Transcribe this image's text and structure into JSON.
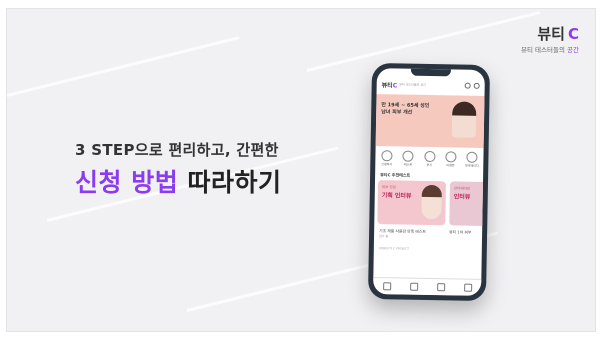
{
  "brand": {
    "logo_text": "뷰티",
    "logo_c": "C",
    "tagline_main": "뷰티 테스터들의",
    "tagline_accent": "공간"
  },
  "headline": {
    "line1": "3 STEP으로 편리하고, 간편한",
    "line2_accent": "신청 방법",
    "line2_rest": "따라하기"
  },
  "phone": {
    "app_logo": "뷰티",
    "app_logo_c": "C",
    "app_tagline": "뷰티 테스터들의 공간",
    "banner_text": "만 19세 ~ 65세 성인남녀 피부 개선",
    "steps": [
      "신청하기",
      "테스트",
      "후기",
      "이벤트",
      "마이페이지"
    ],
    "section_title": "뷰티C 추천테스트",
    "card1_tag": "피부 진정",
    "card1_main": "기획 인터뷰",
    "card2_tag": "안티에이징",
    "card2_main": "인터뷰",
    "caption1": "기초 제품 사용감 만족 테스트",
    "caption2": "뷰티 1차 피부",
    "subcaption": "접수 중",
    "ticker": "VOBEUTI C PROJECT"
  },
  "colors": {
    "accent": "#8a3cf0",
    "background": "#f1f1f3"
  }
}
